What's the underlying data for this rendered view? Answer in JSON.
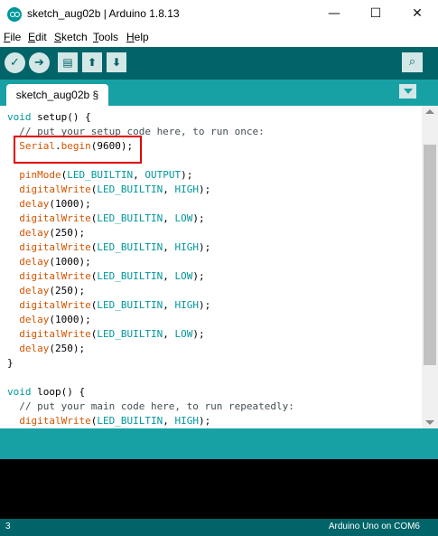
{
  "window": {
    "title": "sketch_aug02b | Arduino 1.8.13",
    "min_glyph": "—",
    "max_glyph": "☐",
    "close_glyph": "✕"
  },
  "menu": {
    "items": [
      {
        "mnemonic": "F",
        "rest": "ile"
      },
      {
        "mnemonic": "E",
        "rest": "dit"
      },
      {
        "mnemonic": "S",
        "rest": "ketch"
      },
      {
        "mnemonic": "T",
        "rest": "ools"
      },
      {
        "mnemonic": "H",
        "rest": "elp"
      }
    ]
  },
  "toolbar": {
    "icons": [
      "verify-icon",
      "upload-icon",
      "new-icon",
      "open-icon",
      "save-icon",
      "serial-monitor-icon"
    ],
    "verify_glyph": "✓",
    "upload_glyph": "➔",
    "new_glyph": "▤",
    "open_glyph": "⬆",
    "save_glyph": "⬇",
    "monitor_glyph": "⌕"
  },
  "tab": {
    "label": "sketch_aug02b §"
  },
  "editor": {
    "lines": [
      [
        {
          "t": "void",
          "c": "kw-type"
        },
        {
          "t": " setup() {",
          "c": ""
        }
      ],
      [
        {
          "t": "  // put your setup code here, to run once:",
          "c": "kw-comment"
        }
      ],
      [
        {
          "t": "  ",
          "c": ""
        },
        {
          "t": "Serial",
          "c": "kw-serial"
        },
        {
          "t": ".",
          "c": ""
        },
        {
          "t": "begin",
          "c": "kw-func"
        },
        {
          "t": "(9600);",
          "c": ""
        }
      ],
      [
        {
          "t": "",
          "c": ""
        }
      ],
      [
        {
          "t": "  ",
          "c": ""
        },
        {
          "t": "pinMode",
          "c": "kw-func"
        },
        {
          "t": "(",
          "c": ""
        },
        {
          "t": "LED_BUILTIN",
          "c": "kw-const"
        },
        {
          "t": ", ",
          "c": ""
        },
        {
          "t": "OUTPUT",
          "c": "kw-const"
        },
        {
          "t": ");",
          "c": ""
        }
      ],
      [
        {
          "t": "  ",
          "c": ""
        },
        {
          "t": "digitalWrite",
          "c": "kw-func"
        },
        {
          "t": "(",
          "c": ""
        },
        {
          "t": "LED_BUILTIN",
          "c": "kw-const"
        },
        {
          "t": ", ",
          "c": ""
        },
        {
          "t": "HIGH",
          "c": "kw-const"
        },
        {
          "t": ");",
          "c": ""
        }
      ],
      [
        {
          "t": "  ",
          "c": ""
        },
        {
          "t": "delay",
          "c": "kw-func"
        },
        {
          "t": "(1000);",
          "c": ""
        }
      ],
      [
        {
          "t": "  ",
          "c": ""
        },
        {
          "t": "digitalWrite",
          "c": "kw-func"
        },
        {
          "t": "(",
          "c": ""
        },
        {
          "t": "LED_BUILTIN",
          "c": "kw-const"
        },
        {
          "t": ", ",
          "c": ""
        },
        {
          "t": "LOW",
          "c": "kw-const"
        },
        {
          "t": ");",
          "c": ""
        }
      ],
      [
        {
          "t": "  ",
          "c": ""
        },
        {
          "t": "delay",
          "c": "kw-func"
        },
        {
          "t": "(250);",
          "c": ""
        }
      ],
      [
        {
          "t": "  ",
          "c": ""
        },
        {
          "t": "digitalWrite",
          "c": "kw-func"
        },
        {
          "t": "(",
          "c": ""
        },
        {
          "t": "LED_BUILTIN",
          "c": "kw-const"
        },
        {
          "t": ", ",
          "c": ""
        },
        {
          "t": "HIGH",
          "c": "kw-const"
        },
        {
          "t": ");",
          "c": ""
        }
      ],
      [
        {
          "t": "  ",
          "c": ""
        },
        {
          "t": "delay",
          "c": "kw-func"
        },
        {
          "t": "(1000);",
          "c": ""
        }
      ],
      [
        {
          "t": "  ",
          "c": ""
        },
        {
          "t": "digitalWrite",
          "c": "kw-func"
        },
        {
          "t": "(",
          "c": ""
        },
        {
          "t": "LED_BUILTIN",
          "c": "kw-const"
        },
        {
          "t": ", ",
          "c": ""
        },
        {
          "t": "LOW",
          "c": "kw-const"
        },
        {
          "t": ");",
          "c": ""
        }
      ],
      [
        {
          "t": "  ",
          "c": ""
        },
        {
          "t": "delay",
          "c": "kw-func"
        },
        {
          "t": "(250);",
          "c": ""
        }
      ],
      [
        {
          "t": "  ",
          "c": ""
        },
        {
          "t": "digitalWrite",
          "c": "kw-func"
        },
        {
          "t": "(",
          "c": ""
        },
        {
          "t": "LED_BUILTIN",
          "c": "kw-const"
        },
        {
          "t": ", ",
          "c": ""
        },
        {
          "t": "HIGH",
          "c": "kw-const"
        },
        {
          "t": ");",
          "c": ""
        }
      ],
      [
        {
          "t": "  ",
          "c": ""
        },
        {
          "t": "delay",
          "c": "kw-func"
        },
        {
          "t": "(1000);",
          "c": ""
        }
      ],
      [
        {
          "t": "  ",
          "c": ""
        },
        {
          "t": "digitalWrite",
          "c": "kw-func"
        },
        {
          "t": "(",
          "c": ""
        },
        {
          "t": "LED_BUILTIN",
          "c": "kw-const"
        },
        {
          "t": ", ",
          "c": ""
        },
        {
          "t": "LOW",
          "c": "kw-const"
        },
        {
          "t": ");",
          "c": ""
        }
      ],
      [
        {
          "t": "  ",
          "c": ""
        },
        {
          "t": "delay",
          "c": "kw-func"
        },
        {
          "t": "(250);",
          "c": ""
        }
      ],
      [
        {
          "t": "}",
          "c": ""
        }
      ],
      [
        {
          "t": "",
          "c": ""
        }
      ],
      [
        {
          "t": "void",
          "c": "kw-type"
        },
        {
          "t": " loop() {",
          "c": ""
        }
      ],
      [
        {
          "t": "  // put your main code here, to run repeatedly:",
          "c": "kw-comment"
        }
      ],
      [
        {
          "t": "  ",
          "c": ""
        },
        {
          "t": "digitalWrite",
          "c": "kw-func"
        },
        {
          "t": "(",
          "c": ""
        },
        {
          "t": "LED_BUILTIN",
          "c": "kw-const"
        },
        {
          "t": ", ",
          "c": ""
        },
        {
          "t": "HIGH",
          "c": "kw-const"
        },
        {
          "t": ");",
          "c": ""
        }
      ]
    ]
  },
  "status": {
    "line_number": "3",
    "board": "Arduino Uno on COM6"
  },
  "colors": {
    "toolbar": "#006468",
    "tabbar": "#17a1a5",
    "highlight": "#e00000"
  }
}
